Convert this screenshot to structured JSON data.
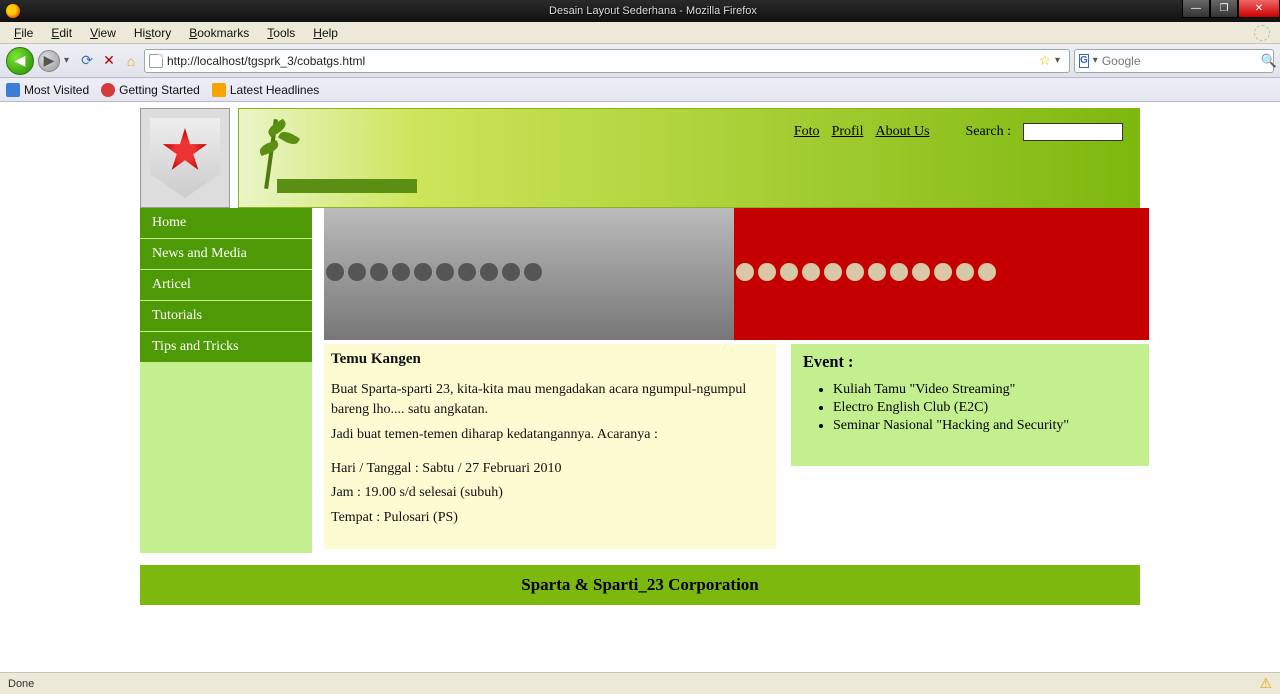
{
  "window": {
    "title": "Desain Layout Sederhana - Mozilla Firefox"
  },
  "menus": {
    "file": "File",
    "edit": "Edit",
    "view": "View",
    "history": "History",
    "bookmarks": "Bookmarks",
    "tools": "Tools",
    "help": "Help"
  },
  "url": "http://localhost/tgsprk_3/cobatgs.html",
  "search_engine_placeholder": "Google",
  "bookmarks_toolbar": {
    "most_visited": "Most Visited",
    "getting_started": "Getting Started",
    "latest_headlines": "Latest Headlines"
  },
  "banner": {
    "links": {
      "foto": "Foto",
      "profil": "Profil",
      "about": "About Us"
    },
    "search_label": "Search :"
  },
  "nav_items": [
    "Home",
    "News and Media",
    "Articel",
    "Tutorials",
    "Tips and Tricks"
  ],
  "article": {
    "title": "Temu Kangen",
    "p1": "Buat Sparta-sparti 23, kita-kita mau mengadakan acara ngumpul-ngumpul bareng lho.... satu angkatan.",
    "p2": "Jadi buat temen-temen diharap kedatangannya. Acaranya :",
    "d1": "Hari / Tanggal : Sabtu / 27 Februari 2010",
    "d2": "Jam : 19.00 s/d selesai (subuh)",
    "d3": "Tempat : Pulosari (PS)"
  },
  "events": {
    "title": "Event :",
    "items": [
      "Kuliah Tamu \"Video Streaming\"",
      "Electro English Club (E2C)",
      "Seminar Nasional \"Hacking and Security\""
    ]
  },
  "footer": "Sparta & Sparti_23 Corporation",
  "status": "Done"
}
